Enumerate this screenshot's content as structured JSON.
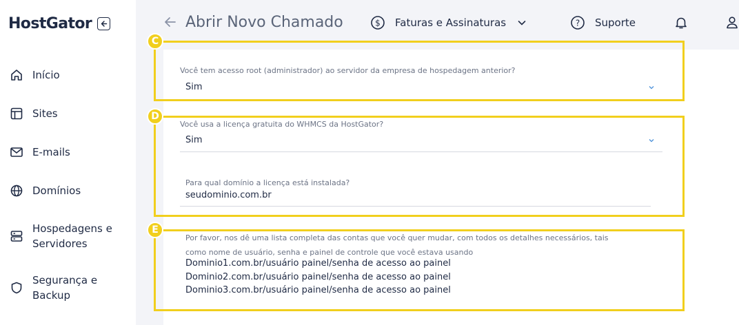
{
  "brand": {
    "logo_text": "HostGator",
    "accent_color": "#f1cf1d"
  },
  "sidebar": {
    "items": [
      {
        "label": "Início",
        "icon": "home-icon"
      },
      {
        "label": "Sites",
        "icon": "layout-icon"
      },
      {
        "label": "E-mails",
        "icon": "mail-icon"
      },
      {
        "label": "Domínios",
        "icon": "globe-icon"
      },
      {
        "label": "Hospedagens e",
        "label2": "Servidores",
        "icon": "server-icon"
      },
      {
        "label": "Segurança e",
        "label2": "Backup",
        "icon": "shield-icon"
      }
    ]
  },
  "header": {
    "title": "Abrir Novo Chamado",
    "billing_label": "Faturas e Assinaturas",
    "support_label": "Suporte"
  },
  "sections": {
    "c": {
      "badge": "C",
      "root_label": "Você tem acesso root (administrador) ao servidor da empresa de hospedagem anterior?",
      "root_value": "Sim"
    },
    "d": {
      "badge": "D",
      "whmcs_label": "Você usa a licença gratuita do WHMCS da HostGator?",
      "whmcs_value": "Sim",
      "domain_label": "Para qual domínio a licença está instalada?",
      "domain_value": "seudominio.com.br"
    },
    "e": {
      "badge": "E",
      "desc_line1": "Por favor, nos dê uma lista completa das contas que você quer mudar, com todos os detalhes necessários, tais",
      "desc_line2": "como nome de usuário, senha e painel de controle que você estava usando",
      "lines": [
        "Dominio1.com.br/usuário painel/senha de acesso ao painel",
        "Dominio2.com.br/usuário painel/senha de acesso ao painel",
        "Dominio3.com.br/usuário painel/senha de acesso ao painel"
      ]
    }
  }
}
